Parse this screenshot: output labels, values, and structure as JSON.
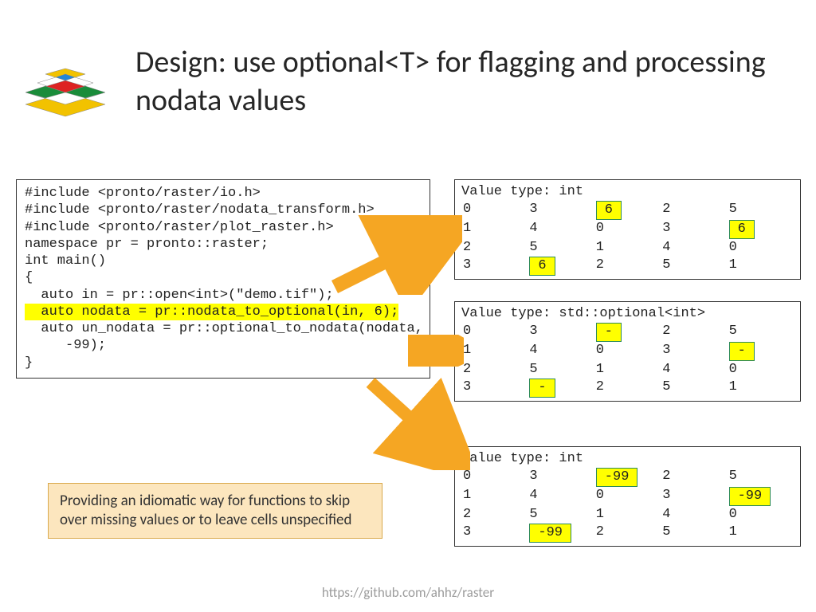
{
  "title": "Design: use optional<T> for flagging and processing nodata values",
  "code": {
    "l1": "#include <pronto/raster/io.h>",
    "l2": "#include <pronto/raster/nodata_transform.h>",
    "l3": "#include <pronto/raster/plot_raster.h>",
    "l4": "",
    "l5": "namespace pr = pronto::raster;",
    "l6": "",
    "l7": "int main()",
    "l8": "{",
    "l9": "  auto in = pr::open<int>(\"demo.tif\");",
    "l10": "  auto nodata = pr::nodata_to_optional(in, 6);",
    "l11": "  auto un_nodata = pr::optional_to_nodata(nodata, ",
    "l12": "     -99);",
    "l13": "}"
  },
  "out1": {
    "header": "Value type: int",
    "rows": [
      [
        "0",
        "3",
        "6",
        "2",
        "5"
      ],
      [
        "1",
        "4",
        "0",
        "3",
        "6"
      ],
      [
        "2",
        "5",
        "1",
        "4",
        "0"
      ],
      [
        "3",
        "6",
        "2",
        "5",
        "1"
      ]
    ],
    "hl": [
      [
        0,
        2
      ],
      [
        1,
        4
      ],
      [
        3,
        1
      ]
    ]
  },
  "out2": {
    "header": "Value type: std::optional<int>",
    "rows": [
      [
        "0",
        "3",
        "-",
        "2",
        "5"
      ],
      [
        "1",
        "4",
        "0",
        "3",
        "-"
      ],
      [
        "2",
        "5",
        "1",
        "4",
        "0"
      ],
      [
        "3",
        "-",
        "2",
        "5",
        "1"
      ]
    ],
    "hl": [
      [
        0,
        2
      ],
      [
        1,
        4
      ],
      [
        3,
        1
      ]
    ]
  },
  "out3": {
    "header": "Value type: int",
    "rows": [
      [
        "0",
        "3",
        "-99",
        "2",
        "5"
      ],
      [
        "1",
        "4",
        "0",
        "3",
        "-99"
      ],
      [
        "2",
        "5",
        "1",
        "4",
        "0"
      ],
      [
        "3",
        "-99",
        "2",
        "5",
        "1"
      ]
    ],
    "hl": [
      [
        0,
        2
      ],
      [
        1,
        4
      ],
      [
        3,
        1
      ]
    ]
  },
  "note": "Providing an idiomatic way for functions to skip over missing values or to leave cells unspecified",
  "footer": "https://github.com/ahhz/raster"
}
